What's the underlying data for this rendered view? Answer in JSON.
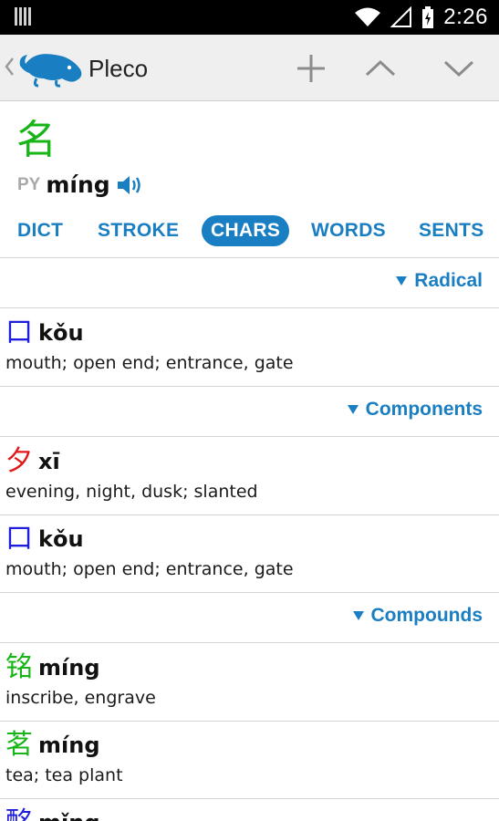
{
  "status_bar": {
    "time": "2:26"
  },
  "toolbar": {
    "app_title": "Pleco"
  },
  "headword": {
    "character": "名",
    "py_label": "PY",
    "pinyin": "míng"
  },
  "tabs": [
    {
      "label": "DICT",
      "active": false
    },
    {
      "label": "STROKE",
      "active": false
    },
    {
      "label": "CHARS",
      "active": true
    },
    {
      "label": "WORDS",
      "active": false
    },
    {
      "label": "SENTS",
      "active": false
    }
  ],
  "sections": {
    "radical": {
      "label": "Radical",
      "entries": [
        {
          "char": "口",
          "pinyin": "kǒu",
          "definition": "mouth; open end; entrance, gate",
          "color": "#1d1ddb"
        }
      ]
    },
    "components": {
      "label": "Components",
      "entries": [
        {
          "char": "夕",
          "pinyin": "xī",
          "definition": "evening, night, dusk; slanted",
          "color": "#e01818"
        },
        {
          "char": "口",
          "pinyin": "kǒu",
          "definition": "mouth; open end; entrance, gate",
          "color": "#1d1ddb"
        }
      ]
    },
    "compounds": {
      "label": "Compounds",
      "entries": [
        {
          "char": "铭",
          "pinyin": "míng",
          "definition": "inscribe, engrave",
          "color": "#18b418"
        },
        {
          "char": "茗",
          "pinyin": "míng",
          "definition": "tea; tea plant",
          "color": "#18b418"
        },
        {
          "char": "酩",
          "pinyin": "mǐng",
          "definition": "",
          "color": "#1d1ddb"
        }
      ]
    }
  },
  "colors": {
    "accent": "#1a7ec2",
    "headword": "#18b418",
    "toolbar_bg": "#efefef"
  }
}
